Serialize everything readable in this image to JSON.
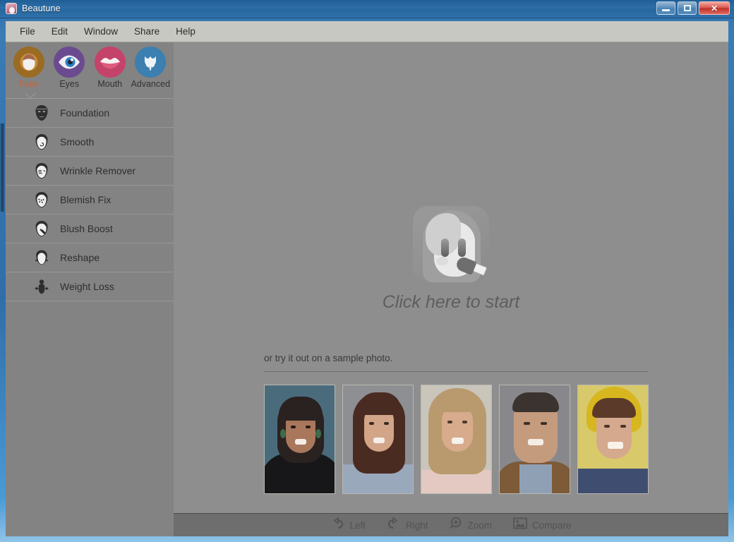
{
  "window": {
    "title": "Beautune",
    "watermark": "",
    "app_icon": "app-logo-icon",
    "controls": {
      "minimize": "minimize-button",
      "maximize": "maximize-button",
      "close_label": "✕"
    }
  },
  "menubar": {
    "items": [
      {
        "label": "File"
      },
      {
        "label": "Edit"
      },
      {
        "label": "Window"
      },
      {
        "label": "Share"
      },
      {
        "label": "Help"
      }
    ]
  },
  "sidebar": {
    "mode_tabs": [
      {
        "label": "Face",
        "icon": "face-icon",
        "color": "#9a6b22",
        "active": true
      },
      {
        "label": "Eyes",
        "icon": "eye-icon",
        "color": "#6b4b8f",
        "active": false
      },
      {
        "label": "Mouth",
        "icon": "lips-icon",
        "color": "#c4436b",
        "active": false
      },
      {
        "label": "Advanced",
        "icon": "tulip-icon",
        "color": "#3c7fb1",
        "active": false
      }
    ],
    "active_tab_color": "#c9633a",
    "effects": [
      {
        "label": "Foundation",
        "icon": "face-foundation-icon"
      },
      {
        "label": "Smooth",
        "icon": "face-smooth-icon"
      },
      {
        "label": "Wrinkle Remover",
        "icon": "face-wrinkle-icon"
      },
      {
        "label": "Blemish Fix",
        "icon": "face-blemish-icon"
      },
      {
        "label": "Blush Boost",
        "icon": "face-blush-icon"
      },
      {
        "label": "Reshape",
        "icon": "face-reshape-icon"
      },
      {
        "label": "Weight Loss",
        "icon": "weight-loss-icon"
      }
    ]
  },
  "content": {
    "start": {
      "avatar_icon": "beautune-girl-avatar-icon",
      "caption": "Click here to start"
    },
    "sample": {
      "text": "or try it out on a sample photo.",
      "thumbs": [
        {
          "name": "sample-photo-1",
          "alt": "smiling woman with dark hair and earrings",
          "bg": "#4a6b7c",
          "skin": "#a9775c",
          "hair": "#2a2220",
          "cloth": "#171719"
        },
        {
          "name": "sample-photo-2",
          "alt": "smiling woman with long brown hair",
          "bg": "#8d8f92",
          "skin": "#d2a589",
          "hair": "#4a2b22",
          "cloth": "#9aa8bb"
        },
        {
          "name": "sample-photo-3",
          "alt": "smiling young woman with blonde hair",
          "bg": "#c9c5bb",
          "skin": "#d8ab8c",
          "hair": "#b99a6e",
          "cloth": "#e3c9c2"
        },
        {
          "name": "sample-photo-4",
          "alt": "smiling man in plaid shirt and brown jacket",
          "bg": "#88888c",
          "skin": "#c59b7e",
          "hair": "#3a332f",
          "cloth": "#7d5a38"
        },
        {
          "name": "sample-photo-5",
          "alt": "smiling woman wearing a yellow knit hat",
          "bg": "#d8c96a",
          "skin": "#d5a98d",
          "hair": "#5b3a2a",
          "cloth": "#3f4e70"
        }
      ]
    }
  },
  "bottombar": {
    "buttons": [
      {
        "label": "Left",
        "icon": "rotate-left-icon"
      },
      {
        "label": "Right",
        "icon": "rotate-right-icon"
      },
      {
        "label": "Zoom",
        "icon": "magnifier-plus-icon"
      },
      {
        "label": "Compare",
        "icon": "image-compare-icon"
      }
    ]
  }
}
